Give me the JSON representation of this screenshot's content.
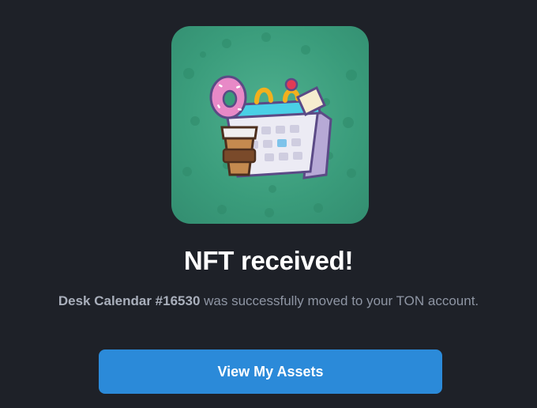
{
  "nft": {
    "icon": "desk-calendar-illustration",
    "card_color": "#3a9c7b"
  },
  "title": "NFT received!",
  "message": {
    "item_name": "Desk Calendar #16530",
    "rest": " was successfully moved to your TON account."
  },
  "button": {
    "label": "View My Assets",
    "color": "#2b8ad9"
  }
}
